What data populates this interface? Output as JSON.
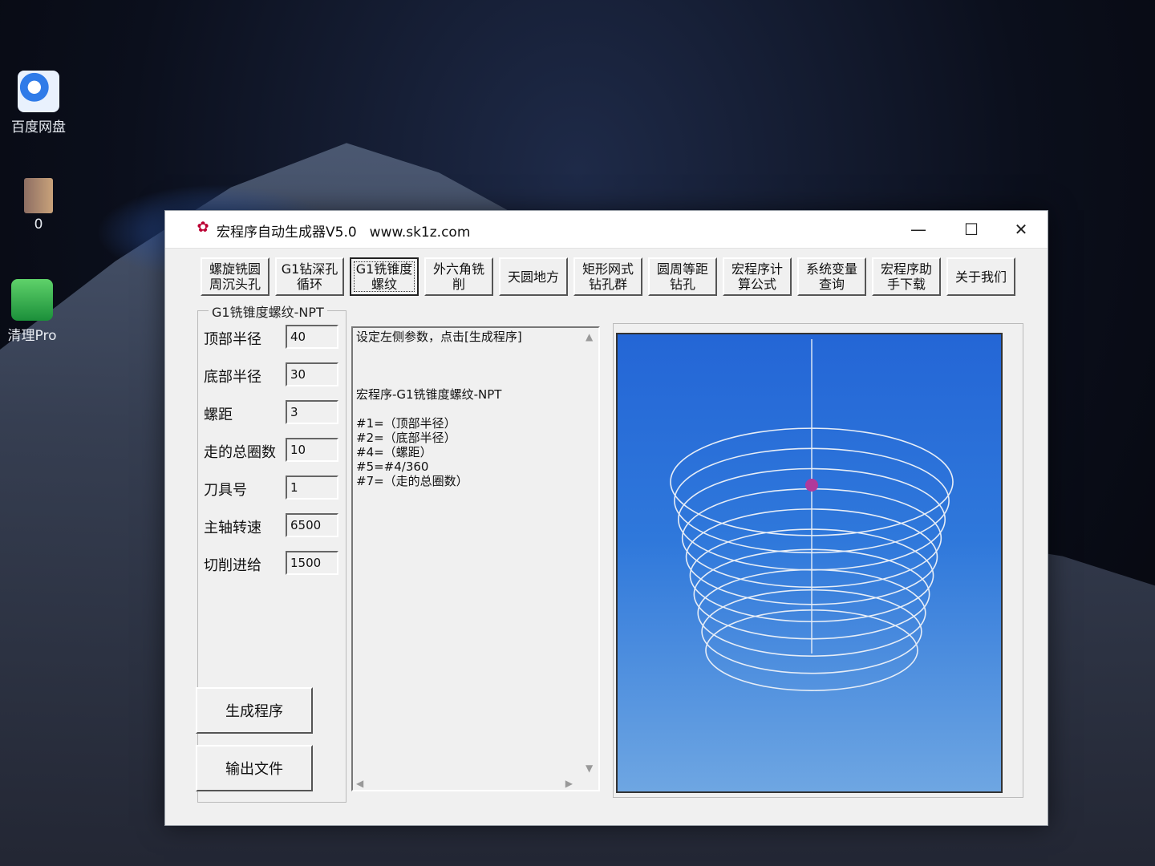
{
  "desktop": {
    "icons": [
      {
        "label": "百度网盘",
        "icon": "baidu-netdisk-icon"
      },
      {
        "label": "0",
        "icon": "door-icon"
      },
      {
        "label": "清理Pro",
        "icon": "cleaner-icon"
      }
    ]
  },
  "window": {
    "title": "宏程序自动生成器V5.0",
    "url": "www.sk1z.com",
    "controls": {
      "minimize": "—",
      "maximize": "☐",
      "close": "✕"
    },
    "tabs": [
      {
        "label": "螺旋铣圆\n周沉头孔"
      },
      {
        "label": "G1钻深孔\n循环"
      },
      {
        "label": "G1铣锥度\n螺纹",
        "active": true
      },
      {
        "label": "外六角铣\n削"
      },
      {
        "label": "天圆地方"
      },
      {
        "label": "矩形网式\n钻孔群"
      },
      {
        "label": "圆周等距\n钻孔"
      },
      {
        "label": "宏程序计\n算公式"
      },
      {
        "label": "系统变量\n查询"
      },
      {
        "label": "宏程序助\n手下载"
      },
      {
        "label": "关于我们"
      }
    ],
    "group_title": "G1铣锥度螺纹-NPT",
    "params": [
      {
        "label": "顶部半径",
        "value": "40"
      },
      {
        "label": "底部半径",
        "value": "30"
      },
      {
        "label": "螺距",
        "value": "3"
      },
      {
        "label": "走的总圈数",
        "value": "10"
      },
      {
        "label": "刀具号",
        "value": "1"
      },
      {
        "label": "主轴转速",
        "value": "6500"
      },
      {
        "label": "切削进给",
        "value": "1500"
      }
    ],
    "buttons": {
      "generate": "生成程序",
      "export": "输出文件"
    },
    "code_text": "设定左侧参数，点击[生成程序]\n\n\n\n宏程序-G1铣锥度螺纹-NPT\n\n#1=（顶部半径）\n#2=（底部半径）\n#4=（螺距）\n#5=#4/360\n#7=（走的总圈数）",
    "preview": {
      "turns": 10,
      "top_radius": 40,
      "bottom_radius": 30,
      "line_color": "#e6edf7",
      "bg_top": "#2466d6",
      "bg_bottom": "#6ea6e2",
      "tool_color": "#b03a9b"
    }
  }
}
